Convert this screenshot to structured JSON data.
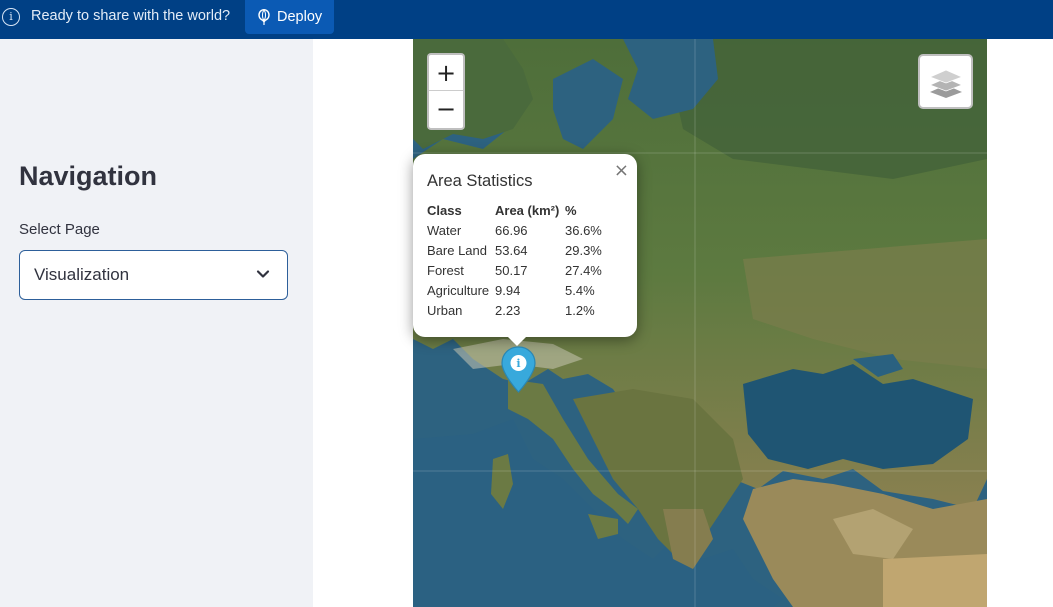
{
  "banner": {
    "message": "Ready to share with the world?",
    "deploy_label": "Deploy",
    "bg_color": "#004085"
  },
  "sidebar": {
    "title": "Navigation",
    "select_label": "Select Page",
    "selected_value": "Visualization"
  },
  "map": {
    "zoom_in": "+",
    "zoom_out": "−",
    "layers_icon": "layers-icon",
    "marker_icon": "info-marker-icon"
  },
  "popup": {
    "close": "×",
    "title": "Area Statistics",
    "headers": [
      "Class",
      "Area (km²)",
      "%"
    ],
    "rows": [
      [
        "Water",
        "66.96",
        "36.6%"
      ],
      [
        "Bare Land",
        "53.64",
        "29.3%"
      ],
      [
        "Forest",
        "50.17",
        "27.4%"
      ],
      [
        "Agriculture",
        "9.94",
        "5.4%"
      ],
      [
        "Urban",
        "2.23",
        "1.2%"
      ]
    ]
  }
}
